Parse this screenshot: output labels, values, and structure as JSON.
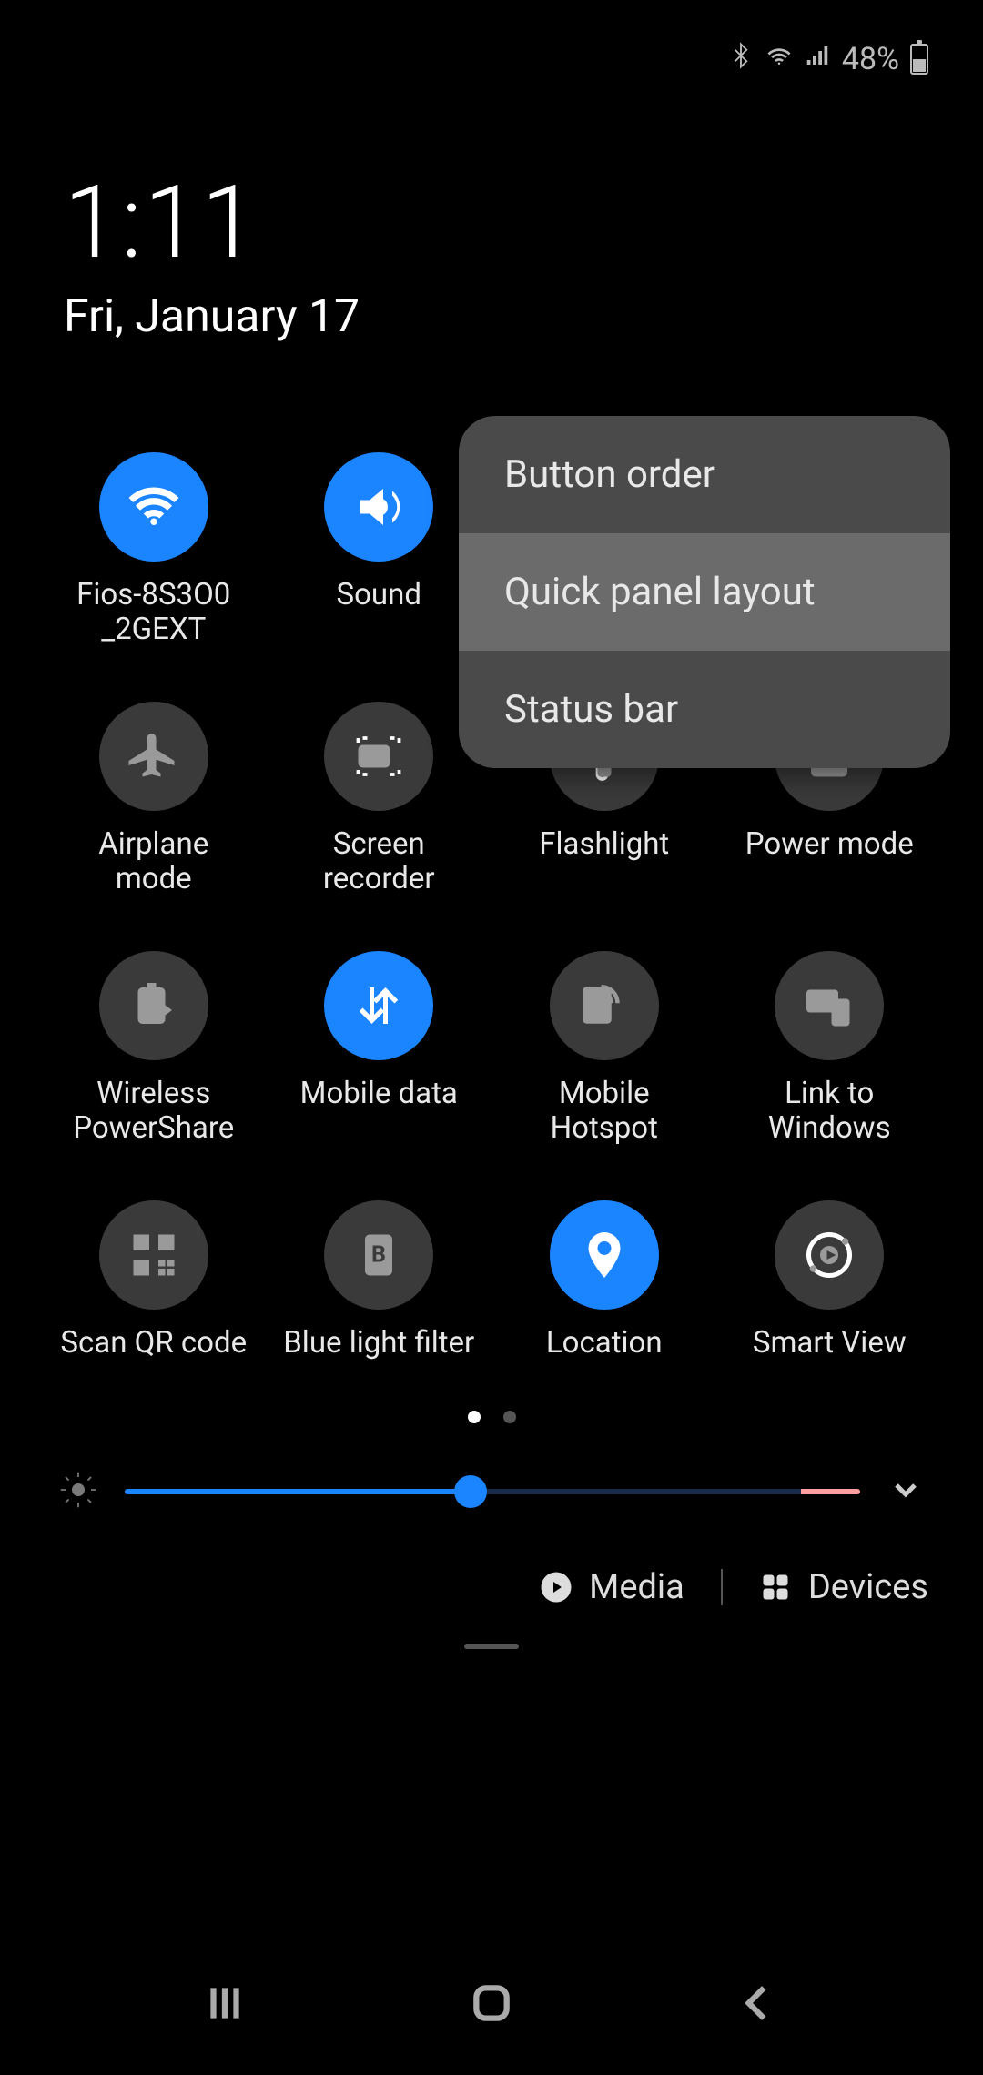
{
  "status": {
    "battery_text": "48%"
  },
  "clock": {
    "time": "1:11",
    "date": "Fri, January 17"
  },
  "tiles": [
    {
      "name": "wifi-tile",
      "label": "Fios-8S3O0_2GEXT",
      "active": true,
      "icon": "wifi"
    },
    {
      "name": "sound-tile",
      "label": "Sound",
      "active": true,
      "icon": "volume"
    },
    {
      "name": "rotate-tile",
      "label": "",
      "active": false,
      "icon": "",
      "hidden_by_popup": true
    },
    {
      "name": "bluetooth-tile",
      "label": "",
      "active": false,
      "icon": "",
      "hidden_by_popup": true
    },
    {
      "name": "airplane-tile",
      "label": "Airplane mode",
      "active": false,
      "icon": "airplane"
    },
    {
      "name": "screen-recorder-tile",
      "label": "Screen recorder",
      "active": false,
      "icon": "recorder"
    },
    {
      "name": "flashlight-tile",
      "label": "Flashlight",
      "active": false,
      "icon": "flashlight"
    },
    {
      "name": "power-mode-tile",
      "label": "Power mode",
      "active": false,
      "icon": "power-mode"
    },
    {
      "name": "wireless-powershare-tile",
      "label": "Wireless PowerShare",
      "active": false,
      "icon": "powershare"
    },
    {
      "name": "mobile-data-tile",
      "label": "Mobile data",
      "active": true,
      "icon": "mobile-data"
    },
    {
      "name": "mobile-hotspot-tile",
      "label": "Mobile Hotspot",
      "active": false,
      "icon": "hotspot"
    },
    {
      "name": "link-windows-tile",
      "label": "Link to Windows",
      "active": false,
      "icon": "link-windows"
    },
    {
      "name": "scan-qr-tile",
      "label": "Scan QR code",
      "active": false,
      "icon": "qr"
    },
    {
      "name": "blue-light-tile",
      "label": "Blue light filter",
      "active": false,
      "icon": "blue-light"
    },
    {
      "name": "location-tile",
      "label": "Location",
      "active": true,
      "icon": "location"
    },
    {
      "name": "smart-view-tile",
      "label": "Smart View",
      "active": false,
      "icon": "smart-view"
    }
  ],
  "popup": {
    "items": [
      {
        "label": "Button order",
        "highlight": false
      },
      {
        "label": "Quick panel layout",
        "highlight": true
      },
      {
        "label": "Status bar",
        "highlight": false
      }
    ]
  },
  "pages": {
    "total": 2,
    "active": 0
  },
  "brightness": {
    "percent": 47
  },
  "footer": {
    "media": "Media",
    "devices": "Devices"
  }
}
